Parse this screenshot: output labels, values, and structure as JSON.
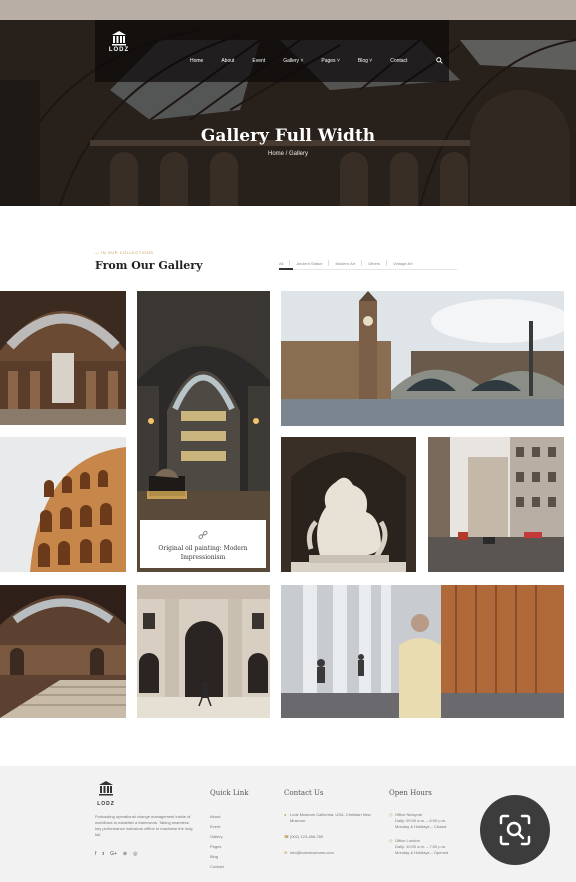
{
  "brand": {
    "logo_text": "LODZ"
  },
  "nav": {
    "items": [
      {
        "label": "Home"
      },
      {
        "label": "About"
      },
      {
        "label": "Event"
      },
      {
        "label": "Gallery ˅"
      },
      {
        "label": "Pages ˅"
      },
      {
        "label": "Blog ˅"
      },
      {
        "label": "Contact"
      }
    ],
    "search_icon": "search-icon"
  },
  "hero": {
    "title": "Gallery Full Width",
    "breadcrumb": "Home / Gallery"
  },
  "section": {
    "kicker": "— IN OUR COLLECTIONS",
    "title": "From Our Gallery",
    "filters": [
      "All",
      "Ancient Statue",
      "Modern Art",
      "Others",
      "Vintage Art"
    ]
  },
  "gallery": {
    "caption": "Original oil painting: Modern Impressionism",
    "caption_icon": "link-icon"
  },
  "footer": {
    "desc": "Podcasting operational change management inside of workflows to establish a framework. Taking seamless key performance indicators offline to maximise the long tail.",
    "social": [
      "f",
      "𝐭",
      "G+",
      "⊕",
      "◎"
    ],
    "quick_link_title": "Quick Link",
    "quick_links": [
      "About",
      "Event",
      "Gallery",
      "Pages",
      "Blog",
      "Contact"
    ],
    "contact_title": "Contact Us",
    "contact": [
      {
        "icon": "map-pin-icon",
        "text": "Lodz Museum California, USA, Christian New Museum"
      },
      {
        "icon": "phone-icon",
        "text": "(002) 123-456-789"
      },
      {
        "icon": "mail-icon",
        "text": "info@lodzmuseums.com"
      }
    ],
    "hours_title": "Open Hours",
    "hours": [
      {
        "icon": "clock-icon",
        "place": "Office Newyork",
        "line1": "Daily: 09:00 a.m. – 6:00 p.m.",
        "line2": "Monday & Holidays – Closed"
      },
      {
        "icon": "clock-icon",
        "place": "Office London",
        "line1": "Daily: 10:00 a.m. – 7:00 p.m.",
        "line2": "Monday & Holidays – Opened"
      }
    ]
  },
  "colors": {
    "accent": "#c49a5a",
    "footer_bg": "#f2f2f2",
    "lens_bg": "#3c3c3c"
  }
}
